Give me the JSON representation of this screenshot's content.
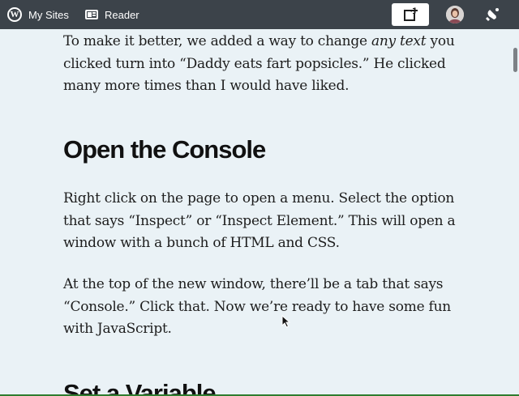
{
  "masterbar": {
    "my_sites_label": "My Sites",
    "reader_label": "Reader",
    "icons": [
      "wordpress-logo-icon",
      "reader-icon",
      "write-post-icon",
      "user-avatar",
      "notifications-bell-icon"
    ]
  },
  "article": {
    "p1_before_em": "To make it better, we added a way to change ",
    "p1_em": "any text",
    "p1_after_em": " you clicked turn into “Daddy eats fart popsicles.” He clicked many more times than I would have liked.",
    "heading_console": "Open the Console",
    "p2": "Right click on the page to open a menu. Select the option that says “Inspect” or “Inspect Element.” This will open a window with a bunch of HTML and CSS.",
    "p3": "At the top of the new window, there’ll be a tab that says “Console.” Click that. Now we’re ready to have some fun with JavaScript.",
    "heading_variable": "Set a Variable"
  },
  "colors": {
    "masterbar_bg": "#3c434a",
    "page_bg": "#eaf2f6",
    "text": "#1d1d1d"
  }
}
